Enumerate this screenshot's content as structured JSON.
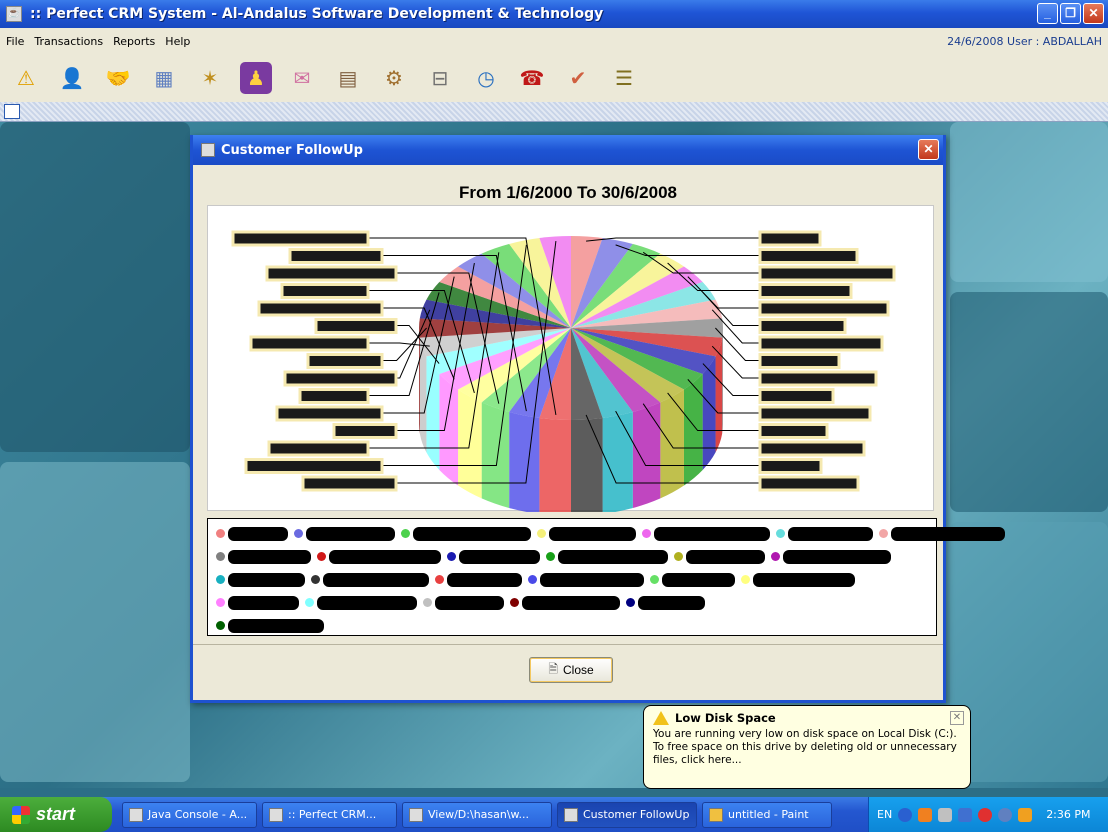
{
  "window": {
    "title": ":: Perfect CRM System - Al-Andalus Software Development & Technology"
  },
  "menubar": {
    "items": [
      "File",
      "Transactions",
      "Reports",
      "Help"
    ],
    "status": "24/6/2008  User : ABDALLAH"
  },
  "toolbar": {
    "icons": [
      "warning-icon",
      "users-icon",
      "handshake-icon",
      "calendar-icon",
      "sparkle-icon",
      "people-icon",
      "mail-icon",
      "book-icon",
      "settings-icon",
      "mailbox-icon",
      "timer-icon",
      "phone-icon",
      "check-icon",
      "notes-icon"
    ]
  },
  "dialog": {
    "title": "Customer FollowUp",
    "close_label": "Close"
  },
  "chart_data": {
    "type": "pie",
    "title": "From 1/6/2000 To 30/6/2008",
    "labels_redacted": true,
    "slice_count": 30,
    "values": [
      1,
      1,
      1,
      1,
      1,
      1,
      1,
      1,
      1,
      1,
      1,
      1,
      1,
      1,
      1,
      1,
      1,
      1,
      1,
      1,
      1,
      1,
      1,
      1,
      1,
      1,
      1,
      1,
      1,
      1
    ],
    "legend_colors": [
      "#f08080",
      "#6a6ae0",
      "#4cd14c",
      "#f5f07a",
      "#ee66ee",
      "#66dddd",
      "#f2a6a6",
      "#808080",
      "#d01818",
      "#1a1ab0",
      "#18a018",
      "#b0b020",
      "#b018b0",
      "#18b0c0",
      "#333333",
      "#e84040",
      "#4a4ae8",
      "#66e066",
      "#ffff80",
      "#ff80ff",
      "#80ffff",
      "#c0c0c0",
      "#800000",
      "#000080",
      "#006000"
    ],
    "legend_rows": [
      7,
      6,
      6,
      5,
      1
    ],
    "legend_position": "bottom"
  },
  "balloon": {
    "title": "Low Disk Space",
    "text": "You are running very low on disk space on Local Disk (C:). To free space on this drive by deleting old or unnecessary files, click here..."
  },
  "taskbar": {
    "start": "start",
    "tasks": [
      {
        "label": "Java Console - A..."
      },
      {
        "label": ":: Perfect CRM..."
      },
      {
        "label": "View/D:\\hasan\\w..."
      },
      {
        "label": "Customer FollowUp"
      },
      {
        "label": "untitled - Paint"
      }
    ],
    "tray_lang": "EN",
    "clock": "2:36 PM"
  }
}
